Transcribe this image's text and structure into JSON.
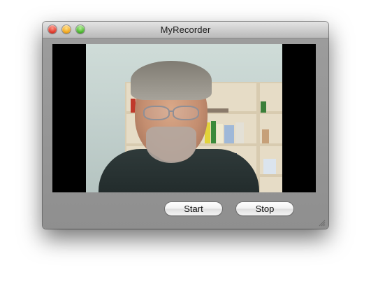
{
  "window": {
    "title": "MyRecorder"
  },
  "controls": {
    "start_label": "Start",
    "stop_label": "Stop"
  },
  "icons": {
    "close": "close-button",
    "minimize": "minimize-button",
    "zoom": "zoom-button",
    "resize": "resize-grip-icon"
  },
  "colors": {
    "close": "#e0392b",
    "minimize": "#f2a81e",
    "zoom": "#4ab62e",
    "window_body": "#9c9c9c"
  }
}
